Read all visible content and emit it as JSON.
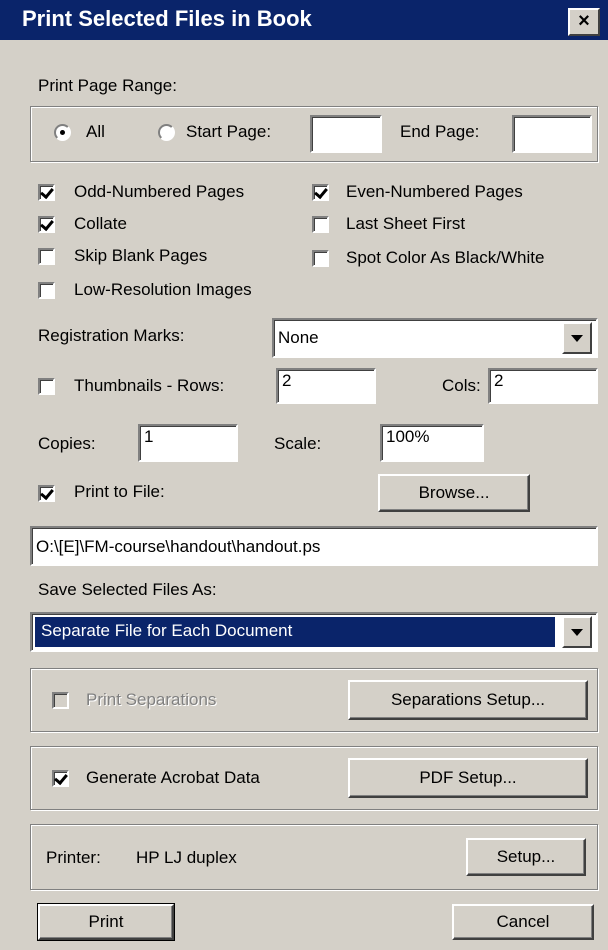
{
  "window": {
    "title": "Print Selected Files in Book",
    "close_glyph": "×"
  },
  "page_range": {
    "label": "Print Page Range:",
    "all_label": "All",
    "start_label": "Start Page:",
    "start_value": "",
    "end_label": "End Page:",
    "end_value": "",
    "selected": "all"
  },
  "options": {
    "odd_pages": {
      "label": "Odd-Numbered Pages",
      "checked": true
    },
    "even_pages": {
      "label": "Even-Numbered Pages",
      "checked": true
    },
    "collate": {
      "label": "Collate",
      "checked": true
    },
    "last_sheet_first": {
      "label": "Last Sheet First",
      "checked": false
    },
    "skip_blank": {
      "label": "Skip Blank Pages",
      "checked": false
    },
    "spot_color": {
      "label": "Spot Color As Black/White",
      "checked": false
    },
    "low_res": {
      "label": "Low-Resolution Images",
      "checked": false
    }
  },
  "registration": {
    "label": "Registration Marks:",
    "value": "None"
  },
  "thumbnails": {
    "label": "Thumbnails - Rows:",
    "checked": false,
    "rows": "2",
    "cols_label": "Cols:",
    "cols": "2"
  },
  "copies": {
    "label": "Copies:",
    "value": "1"
  },
  "scale": {
    "label": "Scale:",
    "value": "100%"
  },
  "print_to_file": {
    "label": "Print to File:",
    "checked": true,
    "browse_label": "Browse...",
    "path": "O:\\[E]\\FM-course\\handout\\handout.ps"
  },
  "save_as": {
    "label": "Save Selected Files As:",
    "value": "Separate File for Each Document"
  },
  "separations": {
    "label": "Print Separations",
    "checked": false,
    "disabled": true,
    "setup_label": "Separations Setup..."
  },
  "acrobat": {
    "label": "Generate Acrobat Data",
    "checked": true,
    "setup_label": "PDF Setup..."
  },
  "printer": {
    "label": "Printer:",
    "name": "HP LJ duplex",
    "setup_label": "Setup..."
  },
  "footer": {
    "print_label": "Print",
    "cancel_label": "Cancel"
  }
}
